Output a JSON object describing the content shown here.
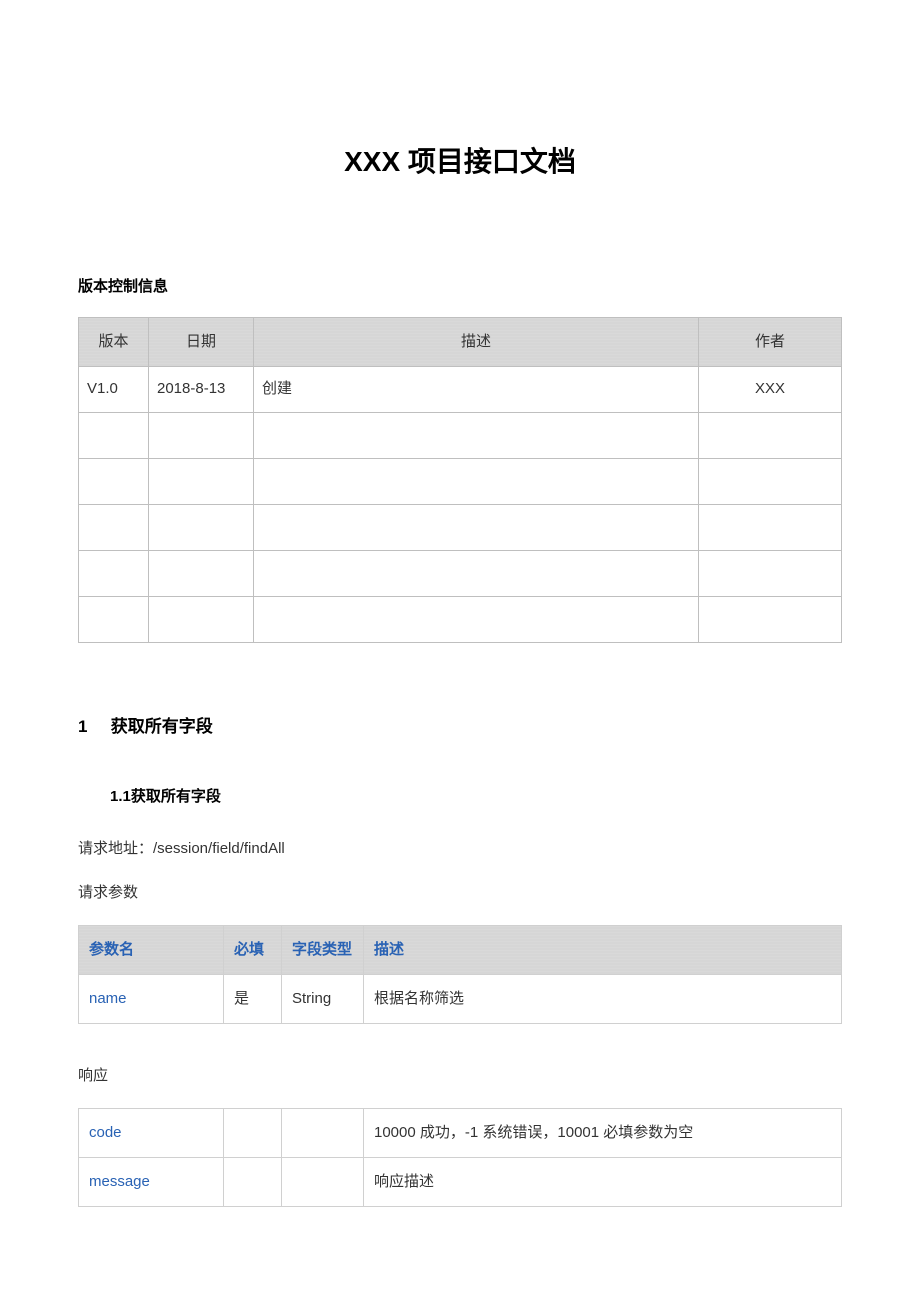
{
  "title": "XXX 项目接口文档",
  "version_section": {
    "label": "版本控制信息",
    "headers": {
      "version": "版本",
      "date": "日期",
      "desc": "描述",
      "author": "作者"
    },
    "rows": [
      {
        "version": "V1.0",
        "date": "2018-8-13",
        "desc": "创建",
        "author": "XXX"
      },
      {
        "version": "",
        "date": "",
        "desc": "",
        "author": ""
      },
      {
        "version": "",
        "date": "",
        "desc": "",
        "author": ""
      },
      {
        "version": "",
        "date": "",
        "desc": "",
        "author": ""
      },
      {
        "version": "",
        "date": "",
        "desc": "",
        "author": ""
      },
      {
        "version": "",
        "date": "",
        "desc": "",
        "author": ""
      }
    ]
  },
  "section1": {
    "num": "1",
    "title": "获取所有字段",
    "sub": {
      "num": "1.1",
      "title": "获取所有字段",
      "request_url_label": "请求地址：/session/field/findAll",
      "params_label": "请求参数",
      "params_headers": {
        "name": "参数名",
        "required": "必填",
        "type": "字段类型",
        "desc": "描述"
      },
      "params_rows": [
        {
          "name": "name",
          "required": "是",
          "type": "String",
          "desc": "根据名称筛选"
        }
      ],
      "response_label": "响应",
      "response_rows": [
        {
          "name": "code",
          "c2": "",
          "c3": "",
          "desc": "10000 成功，-1 系统错误，10001 必填参数为空"
        },
        {
          "name": "message",
          "c2": "",
          "c3": "",
          "desc": "响应描述"
        }
      ]
    }
  }
}
